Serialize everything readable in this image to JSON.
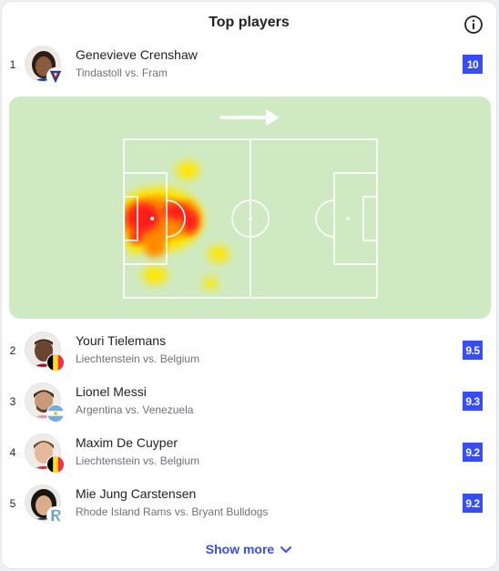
{
  "widget": {
    "title": "Top players",
    "show_more_label": "Show more"
  },
  "players": [
    {
      "rank": "1",
      "name": "Genevieve Crenshaw",
      "match": "Tindastoll vs. Fram",
      "rating": "10"
    },
    {
      "rank": "2",
      "name": "Youri Tielemans",
      "match": "Liechtenstein vs. Belgium",
      "rating": "9.5"
    },
    {
      "rank": "3",
      "name": "Lionel Messi",
      "match": "Argentina vs. Venezuela",
      "rating": "9.3"
    },
    {
      "rank": "4",
      "name": "Maxim De Cuyper",
      "match": "Liechtenstein vs. Belgium",
      "rating": "9.2"
    },
    {
      "rank": "5",
      "name": "Mie Jung Carstensen",
      "match": "Rhode Island Rams vs. Bryant Bulldogs",
      "rating": "9.2"
    }
  ],
  "heatmap": {
    "attack_direction": "right",
    "intensity_colors": [
      "#ff1a1a",
      "#ff8a00",
      "#ffe600"
    ]
  },
  "colors": {
    "rating_bg": "#374df5",
    "link": "#374df5",
    "pitch": "#cfeac2"
  }
}
